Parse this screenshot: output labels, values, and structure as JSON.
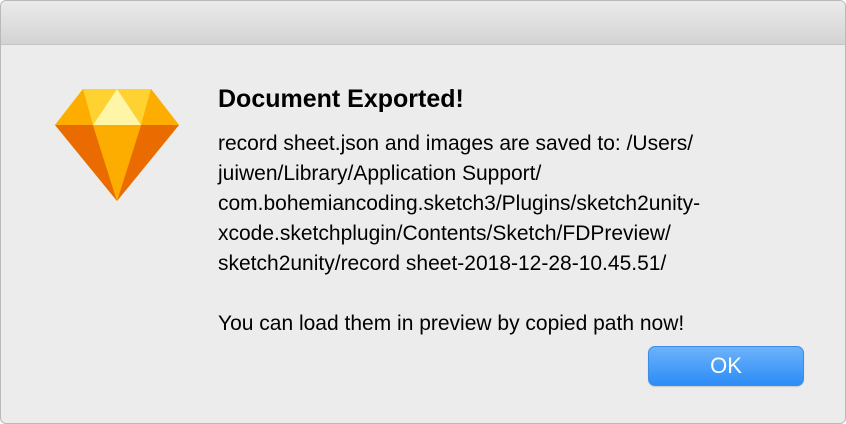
{
  "dialog": {
    "title": "Document Exported!",
    "message_lines": [
      "record sheet.json and images are saved to: /Users/",
      "juiwen/Library/Application Support/",
      "com.bohemiancoding.sketch3/Plugins/sketch2unity-",
      "xcode.sketchplugin/Contents/Sketch/FDPreview/",
      "sketch2unity/record sheet-2018-12-28-10.45.51/"
    ],
    "footer_message": "You can load them in preview by copied path now!",
    "ok_label": "OK",
    "icon": "sketch-diamond-icon"
  },
  "colors": {
    "window_bg": "#ececec",
    "button_blue": "#2c8cf6",
    "diamond_orange": "#f6a623",
    "diamond_yellow": "#fdd231"
  }
}
